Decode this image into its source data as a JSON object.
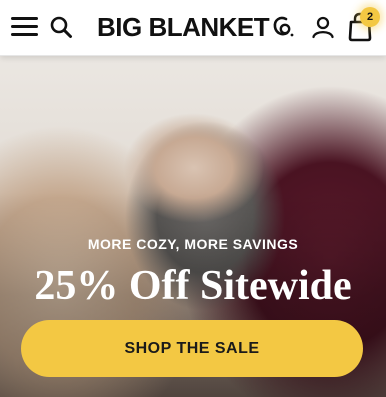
{
  "header": {
    "brand_name": "BIG BLANKET",
    "brand_mark": "Co",
    "cart_count": "2",
    "icons": [
      "menu-icon",
      "search-icon",
      "brand-logo",
      "account-icon",
      "bag-icon"
    ]
  },
  "hero": {
    "eyebrow": "MORE COZY, MORE SAVINGS",
    "headline": "25% Off Sitewide",
    "cta_label": "SHOP THE SALE"
  },
  "colors": {
    "accent": "#f3c843",
    "text_dark": "#111111",
    "text_light": "#ffffff"
  }
}
